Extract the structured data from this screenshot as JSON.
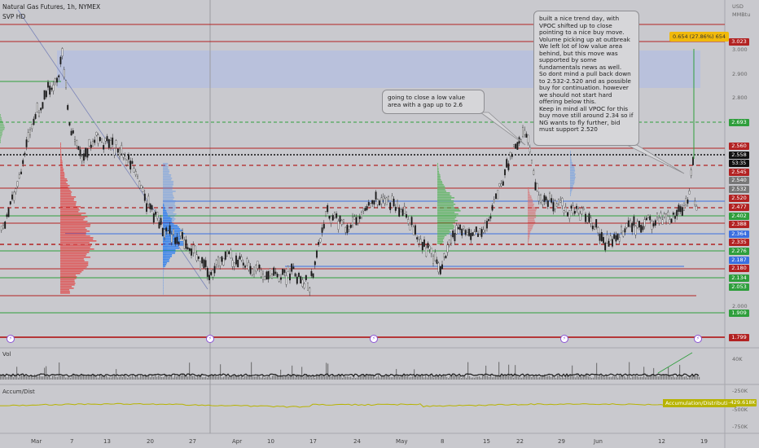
{
  "header": {
    "title": "Natural Gas Futures, 1h, NYMEX",
    "indicator": "SVP HD",
    "currency": "USD",
    "unit": "MMBtu"
  },
  "price_axis": {
    "ticks": [
      "3.000",
      "2.900",
      "2.800",
      "2.000"
    ],
    "labels": [
      {
        "value": "3.023",
        "color": "#b22222"
      },
      {
        "value": "2.693",
        "color": "#2e9e3c"
      },
      {
        "value": "2.560",
        "color": "#b22222"
      },
      {
        "value": "2.558",
        "color": "#111111"
      },
      {
        "value": "53:35",
        "color": "#111111"
      },
      {
        "value": "2.545",
        "color": "#b22222"
      },
      {
        "value": "2.540",
        "color": "#777777"
      },
      {
        "value": "2.532",
        "color": "#777777"
      },
      {
        "value": "2.520",
        "color": "#b22222"
      },
      {
        "value": "2.477",
        "color": "#b22222"
      },
      {
        "value": "2.402",
        "color": "#2e9e3c"
      },
      {
        "value": "2.388",
        "color": "#b22222"
      },
      {
        "value": "2.364",
        "color": "#3b6fe0"
      },
      {
        "value": "2.335",
        "color": "#b22222"
      },
      {
        "value": "2.276",
        "color": "#2e9e3c"
      },
      {
        "value": "2.187",
        "color": "#3b6fe0"
      },
      {
        "value": "2.180",
        "color": "#b22222"
      },
      {
        "value": "2.134",
        "color": "#2e9e3c"
      },
      {
        "value": "2.053",
        "color": "#2e9e3c"
      },
      {
        "value": "1.909",
        "color": "#2e9e3c"
      },
      {
        "value": "1.799",
        "color": "#b22222"
      }
    ]
  },
  "annotations": {
    "short_note": "going to close a low value area with a gap up to 2.6",
    "long_note": "built a nice trend day, with VPOC shifted up to close pointing to a nice buy move. Volume picking up at outbreak\nWe left lot of low value area behind, but this move was supported by some fundamentals news as well.\nSo dont mind a pull back down to 2.532-2.520 and as possible buy for continuation. however we should not start hard offering below this.\nKeep in mind all VPOC for this buy move still around 2.34 so if NG wants to fly further, bid must support 2.520",
    "measure": "0.654 (27.86%) 654"
  },
  "volume_pane": {
    "label": "Vol",
    "ticks": [
      "40K",
      "-250K"
    ]
  },
  "accum_pane": {
    "label": "Accum/Dist",
    "indicator_name": "Accumulation/Distribution",
    "value": "-429.618K",
    "ticks": [
      "-500K",
      "-750K"
    ]
  },
  "time_axis": {
    "labels": [
      "Mar",
      "7",
      "13",
      "20",
      "27",
      "Apr",
      "10",
      "17",
      "24",
      "May",
      "8",
      "15",
      "22",
      "29",
      "Jun",
      "12",
      "19"
    ]
  },
  "events": {
    "glyph": "⚡"
  },
  "colors": {
    "background": "#c9c9ce",
    "support": "#2e9e3c",
    "resistance": "#b22222",
    "value_area": "#3b6fe0",
    "volume_profile_red": "#e04a4a",
    "volume_profile_blue": "#2f7ff0",
    "volume_profile_green": "#4cb050",
    "accum_line": "#b7b300"
  }
}
